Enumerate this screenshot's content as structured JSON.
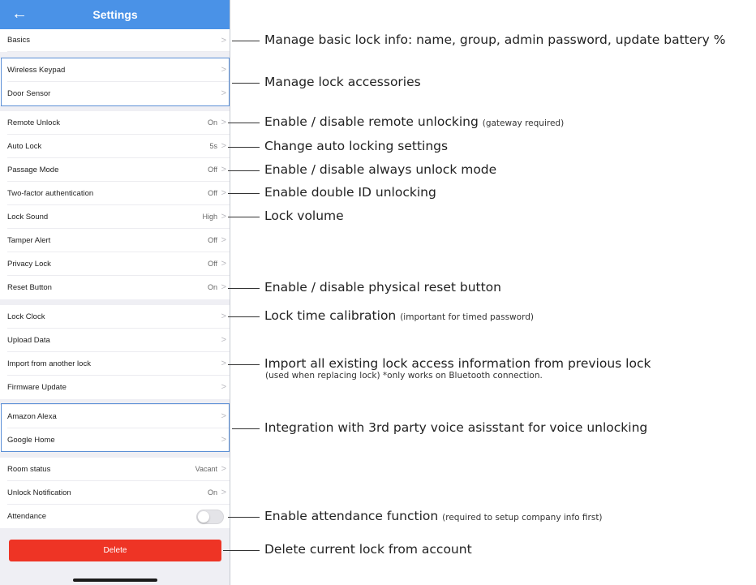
{
  "nav": {
    "title": "Settings",
    "back_icon": "arrow-left-icon",
    "back_glyph": "←"
  },
  "rows": {
    "basics": {
      "label": "Basics",
      "value": ""
    },
    "wireless_keypad": {
      "label": "Wireless Keypad",
      "value": ""
    },
    "door_sensor": {
      "label": "Door Sensor",
      "value": ""
    },
    "remote_unlock": {
      "label": "Remote Unlock",
      "value": "On"
    },
    "auto_lock": {
      "label": "Auto Lock",
      "value": "5s"
    },
    "passage_mode": {
      "label": "Passage Mode",
      "value": "Off"
    },
    "two_factor": {
      "label": "Two-factor authentication",
      "value": "Off"
    },
    "lock_sound": {
      "label": "Lock Sound",
      "value": "High"
    },
    "tamper_alert": {
      "label": "Tamper Alert",
      "value": "Off"
    },
    "privacy_lock": {
      "label": "Privacy Lock",
      "value": "Off"
    },
    "reset_button": {
      "label": "Reset Button",
      "value": "On"
    },
    "lock_clock": {
      "label": "Lock Clock",
      "value": ""
    },
    "upload_data": {
      "label": "Upload Data",
      "value": ""
    },
    "import_lock": {
      "label": "Import from another lock",
      "value": ""
    },
    "firmware_update": {
      "label": "Firmware Update",
      "value": ""
    },
    "amazon_alexa": {
      "label": "Amazon Alexa",
      "value": ""
    },
    "google_home": {
      "label": "Google Home",
      "value": ""
    },
    "room_status": {
      "label": "Room status",
      "value": "Vacant"
    },
    "unlock_notification": {
      "label": "Unlock Notification",
      "value": "On"
    },
    "attendance": {
      "label": "Attendance",
      "toggle_on": false
    }
  },
  "chevron_glyph": ">",
  "delete_label": "Delete",
  "colors": {
    "nav_bar": "#4a92e7",
    "delete": "#ee3425",
    "group_border": "#5b8fd6"
  },
  "annotations": {
    "basics": {
      "text": "Manage basic lock info: name, group, admin password, update battery %"
    },
    "accessories": {
      "text": "Manage lock accessories"
    },
    "remote_unlock": {
      "text": "Enable / disable remote unlocking",
      "note": "(gateway required)"
    },
    "auto_lock": {
      "text": "Change auto locking settings"
    },
    "passage_mode": {
      "text": "Enable / disable always unlock mode"
    },
    "two_factor": {
      "text": "Enable double ID unlocking"
    },
    "lock_sound": {
      "text": "Lock volume"
    },
    "reset_button": {
      "text": "Enable / disable physical reset button"
    },
    "lock_clock": {
      "text": "Lock time calibration",
      "note": "(important for timed password)"
    },
    "import_lock": {
      "text": "Import all existing lock access information from previous lock",
      "note": "(used when replacing lock) *only works on Bluetooth connection."
    },
    "voice": {
      "text": "Integration with 3rd party voice asisstant for voice unlocking"
    },
    "attendance": {
      "text": "Enable attendance function",
      "note": "(required to setup company info first)"
    },
    "delete": {
      "text": "Delete current lock from account"
    }
  }
}
